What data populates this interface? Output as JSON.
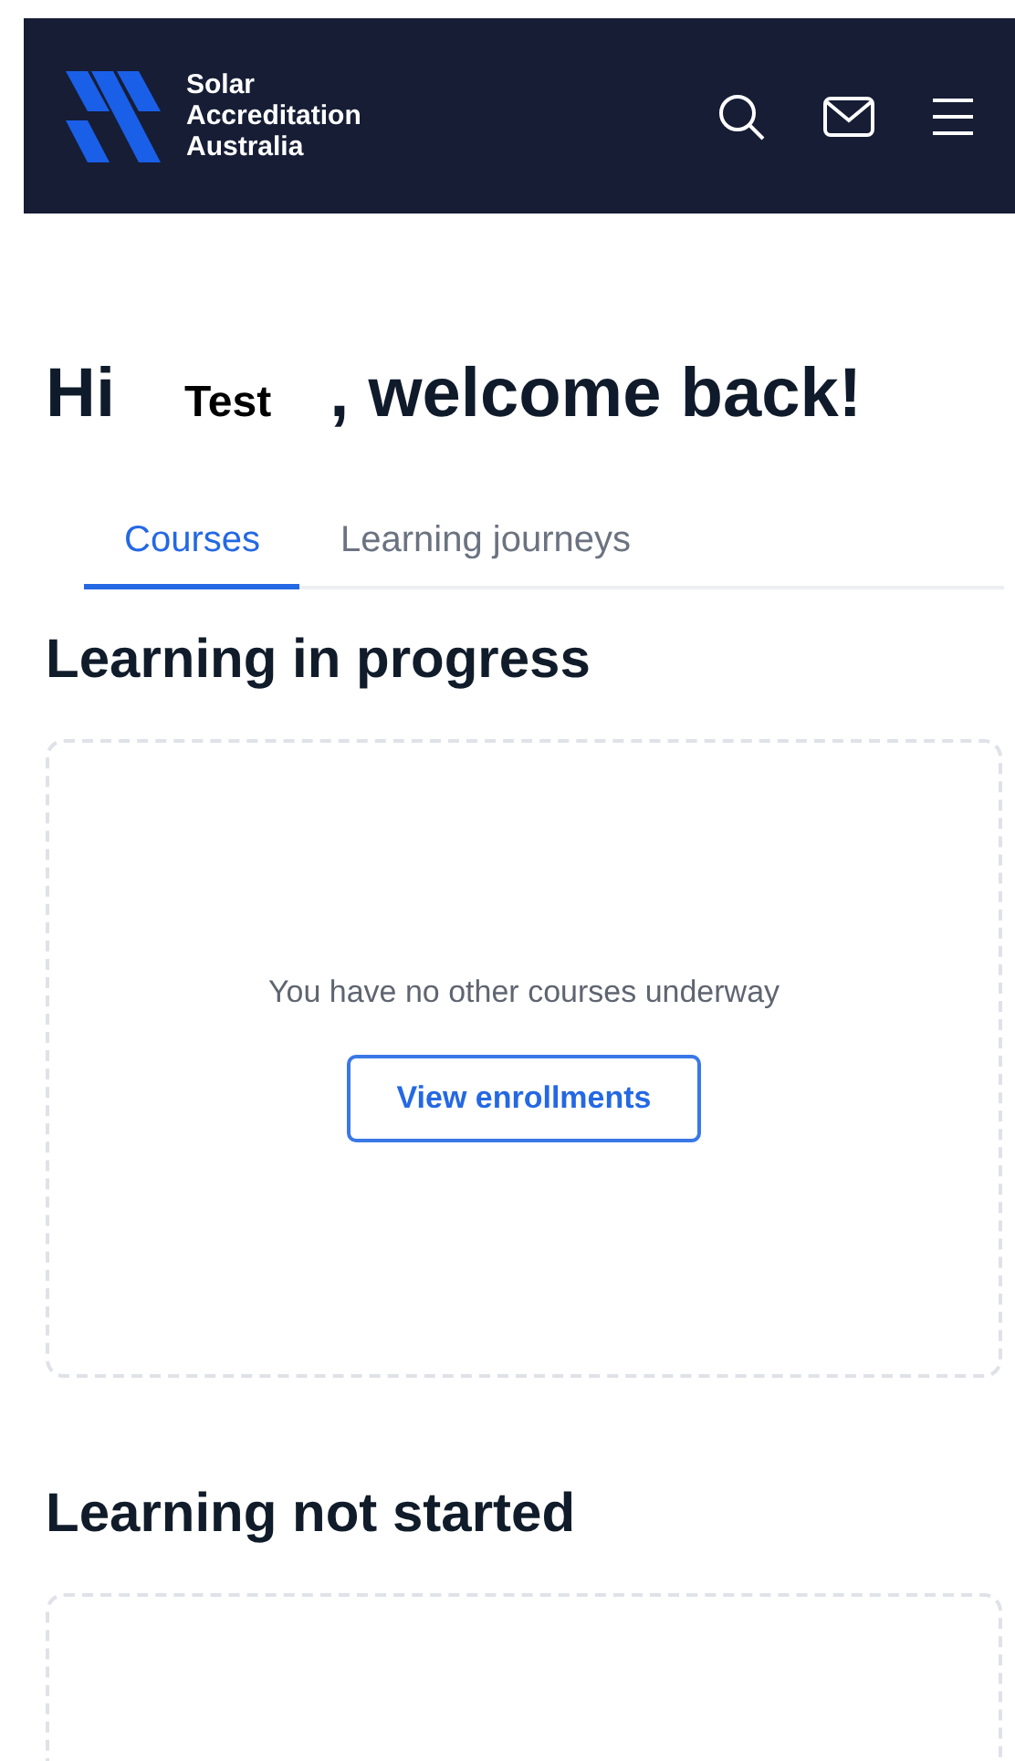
{
  "header": {
    "logo_text": [
      "Solar",
      "Accreditation",
      "Australia"
    ]
  },
  "greeting": {
    "hi": "Hi",
    "name": "Test",
    "rest": ", welcome back!"
  },
  "tabs": [
    {
      "label": "Courses",
      "selected": true
    },
    {
      "label": "Learning journeys",
      "selected": false
    }
  ],
  "sections": [
    {
      "title": "Learning in progress",
      "empty_message": "You have no other courses underway",
      "button": "View enrollments"
    },
    {
      "title": "Learning not started"
    }
  ]
}
